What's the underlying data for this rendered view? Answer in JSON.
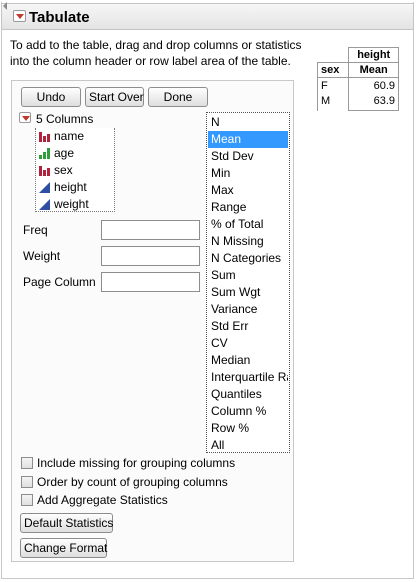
{
  "window": {
    "title": "Tabulate"
  },
  "instructions": "To add to the table, drag and drop columns or statistics into the column header or row label area of the table.",
  "result_table": {
    "col_header": "height",
    "row_var": "sex",
    "stat_header": "Mean",
    "rows": [
      {
        "label": "F",
        "value": "60.9"
      },
      {
        "label": "M",
        "value": "63.9"
      }
    ]
  },
  "toolbar": {
    "undo": "Undo",
    "start_over": "Start Over",
    "done": "Done"
  },
  "columns": {
    "header": "5 Columns",
    "items": [
      {
        "name": "name",
        "type": "nominal"
      },
      {
        "name": "age",
        "type": "ordinal"
      },
      {
        "name": "sex",
        "type": "nominal"
      },
      {
        "name": "height",
        "type": "continuous"
      },
      {
        "name": "weight",
        "type": "continuous"
      }
    ]
  },
  "fields": {
    "freq": "Freq",
    "weight": "Weight",
    "page_column": "Page Column"
  },
  "statistics": {
    "selected": "Mean",
    "items": [
      "N",
      "Mean",
      "Std Dev",
      "Min",
      "Max",
      "Range",
      "% of Total",
      "N Missing",
      "N Categories",
      "Sum",
      "Sum Wgt",
      "Variance",
      "Std Err",
      "CV",
      "Median",
      "Interquartile Range",
      "Quantiles",
      "Column %",
      "Row %",
      "All"
    ]
  },
  "options": {
    "include_missing": "Include missing for grouping columns",
    "order_by_count": "Order by count of grouping columns",
    "add_aggregate": "Add Aggregate Statistics"
  },
  "buttons": {
    "default_statistics": "Default Statistics",
    "change_format": "Change Format"
  },
  "colors": {
    "nominal": "#b0233a",
    "ordinal": "#2e9e3a",
    "continuous": "#2f4fa3",
    "selection": "#3399ff"
  }
}
